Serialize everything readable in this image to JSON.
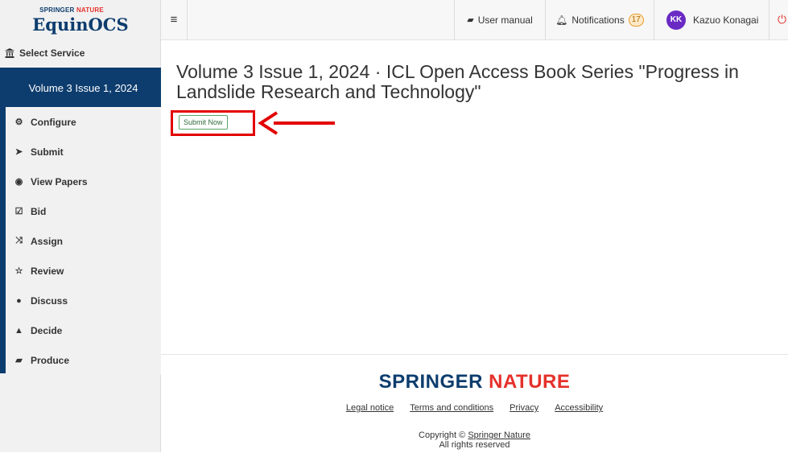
{
  "sidebar": {
    "logo_top_1": "SPRINGER",
    "logo_top_2": "NATURE",
    "logo_main": "EquinOCS",
    "select_service": "Select Service",
    "active_item": "Volume 3 Issue 1, 2024",
    "items": [
      {
        "label": "Configure",
        "icon": "gears-icon"
      },
      {
        "label": "Submit",
        "icon": "paper-plane-icon"
      },
      {
        "label": "View Papers",
        "icon": "eye-icon"
      },
      {
        "label": "Bid",
        "icon": "checkbox-icon"
      },
      {
        "label": "Assign",
        "icon": "shuffle-icon"
      },
      {
        "label": "Review",
        "icon": "star-icon"
      },
      {
        "label": "Discuss",
        "icon": "comments-icon"
      },
      {
        "label": "Decide",
        "icon": "thumbs-up-icon"
      },
      {
        "label": "Produce",
        "icon": "book-icon"
      }
    ]
  },
  "topbar": {
    "user_manual": "User manual",
    "notifications_label": "Notifications",
    "notifications_count": "17",
    "avatar_initials": "KK",
    "user_name": "Kazuo Konagai"
  },
  "main": {
    "title": "Volume 3 Issue 1, 2024 · ICL Open Access Book Series \"Progress in Landslide Research and Technology\"",
    "submit_now": "Submit Now"
  },
  "footer": {
    "brand_1": "SPRINGER",
    "brand_2": "NATURE",
    "links": [
      "Legal notice",
      "Terms and conditions",
      "Privacy",
      "Accessibility"
    ],
    "copyright_prefix": "Copyright ©",
    "copyright_link": "Springer Nature",
    "rights": "All rights reserved"
  },
  "colors": {
    "navy": "#0d3d6e",
    "brand_red": "#e5312b",
    "annotation_red": "#e30000",
    "submit_green": "#5aa469",
    "avatar_purple": "#6a2bc4"
  }
}
